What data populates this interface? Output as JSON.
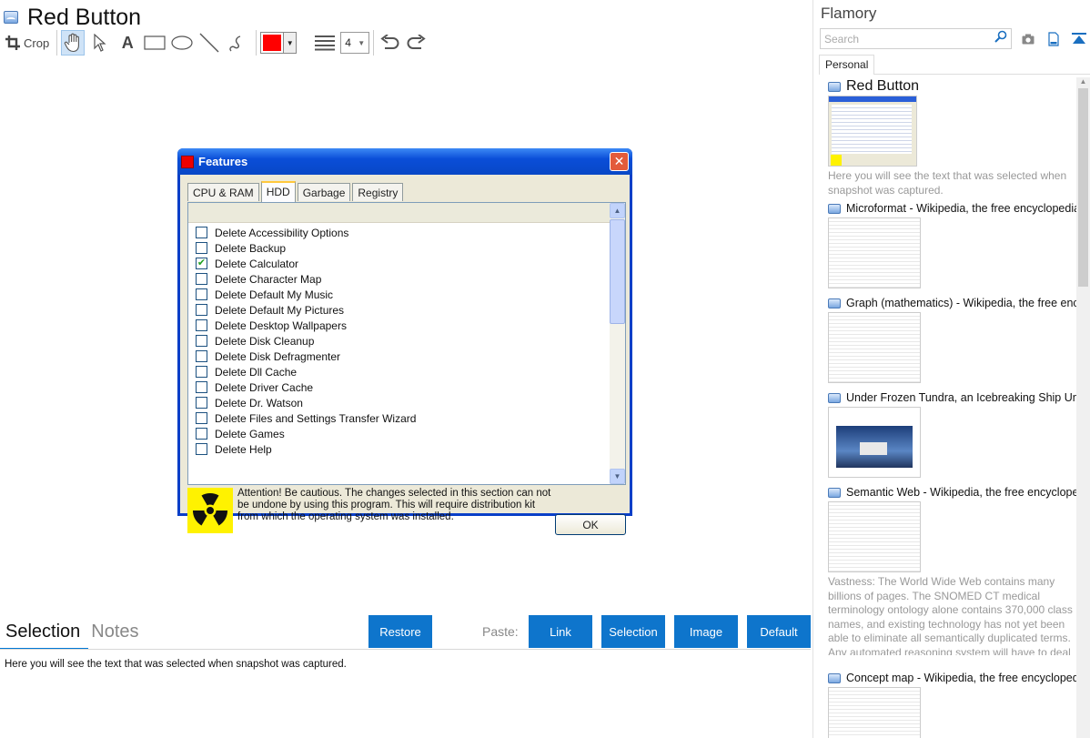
{
  "app": {
    "doc_title": "Red Button",
    "crop_label": "Crop",
    "line_width": "4",
    "accent_color": "#0e75cc",
    "stroke_color": "#ff0000"
  },
  "dialog": {
    "title": "Features",
    "close_label": "✕",
    "tabs": [
      "CPU & RAM",
      "HDD",
      "Garbage",
      "Registry"
    ],
    "selected_tab": "HDD",
    "items": [
      {
        "label": "Delete Accessibility Options",
        "checked": false
      },
      {
        "label": "Delete Backup",
        "checked": false
      },
      {
        "label": "Delete Calculator",
        "checked": true
      },
      {
        "label": "Delete Character Map",
        "checked": false
      },
      {
        "label": "Delete Default My Music",
        "checked": false
      },
      {
        "label": "Delete Default My Pictures",
        "checked": false
      },
      {
        "label": "Delete Desktop Wallpapers",
        "checked": false
      },
      {
        "label": "Delete Disk Cleanup",
        "checked": false
      },
      {
        "label": "Delete Disk Defragmenter",
        "checked": false
      },
      {
        "label": "Delete Dll Cache",
        "checked": false
      },
      {
        "label": "Delete Driver Cache",
        "checked": false
      },
      {
        "label": "Delete Dr. Watson",
        "checked": false
      },
      {
        "label": "Delete Files and Settings Transfer Wizard",
        "checked": false
      },
      {
        "label": "Delete Games",
        "checked": false
      },
      {
        "label": "Delete Help",
        "checked": false
      }
    ],
    "warning": "Attention! Be cautious. The changes selected in this section can not be undone by using this program. This will require distribution kit from which the operating system was installed.",
    "ok_label": "OK"
  },
  "bottom": {
    "tab_selection": "Selection",
    "tab_notes": "Notes",
    "restore": "Restore",
    "paste_label": "Paste:",
    "paste_link": "Link",
    "paste_selection": "Selection",
    "paste_image": "Image",
    "paste_default": "Default",
    "selection_text": "Here you will see the text that was selected when snapshot was captured."
  },
  "sidebar": {
    "brand": "Flamory",
    "search_placeholder": "Search",
    "tab_personal": "Personal",
    "entries": [
      {
        "title": "Red Button",
        "desc": "Here you will see the text that was selected when snapshot was captured."
      },
      {
        "title": "Microformat - Wikipedia, the free encyclopedia",
        "desc": ""
      },
      {
        "title": "Graph (mathematics) - Wikipedia, the free ency",
        "desc": ""
      },
      {
        "title": "Under Frozen Tundra, an Icebreaking Ship Unco",
        "desc": ""
      },
      {
        "title": "Semantic Web - Wikipedia, the free encycloped",
        "desc": "Vastness: The World Wide Web contains many billions of pages. The SNOMED CT medical terminology ontology alone contains 370,000 class names, and existing technology has not yet been able to eliminate all semantically duplicated terms. Any automated reasoning system will have to deal with truly huge inputs."
      },
      {
        "title": "Concept map - Wikipedia, the free encyclopedi",
        "desc": ""
      }
    ]
  }
}
